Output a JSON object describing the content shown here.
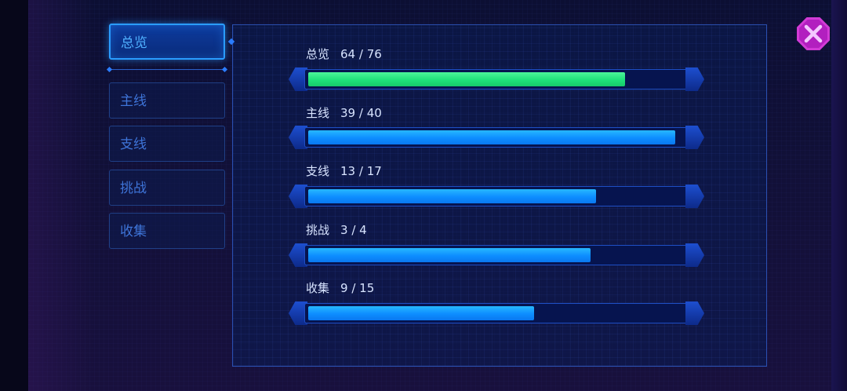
{
  "tabs": [
    {
      "label": "总览",
      "active": true
    },
    {
      "label": "主线",
      "active": false
    },
    {
      "label": "支线",
      "active": false
    },
    {
      "label": "挑战",
      "active": false
    },
    {
      "label": "收集",
      "active": false
    }
  ],
  "progress": [
    {
      "name": "总览",
      "count": "64 / 76",
      "fraction": 0.842,
      "color": "green"
    },
    {
      "name": "主线",
      "count": "39 / 40",
      "fraction": 0.975,
      "color": "blue"
    },
    {
      "name": "支线",
      "count": "13 / 17",
      "fraction": 0.765,
      "color": "blue"
    },
    {
      "name": "挑战",
      "count": "3 / 4",
      "fraction": 0.75,
      "color": "blue"
    },
    {
      "name": "收集",
      "count": "9 / 15",
      "fraction": 0.6,
      "color": "blue"
    }
  ],
  "colors": {
    "fill_green": "#1fe07a",
    "fill_blue": "#0d8dff",
    "close": "#d23bd6"
  },
  "close_button": {
    "icon": "close-icon"
  }
}
